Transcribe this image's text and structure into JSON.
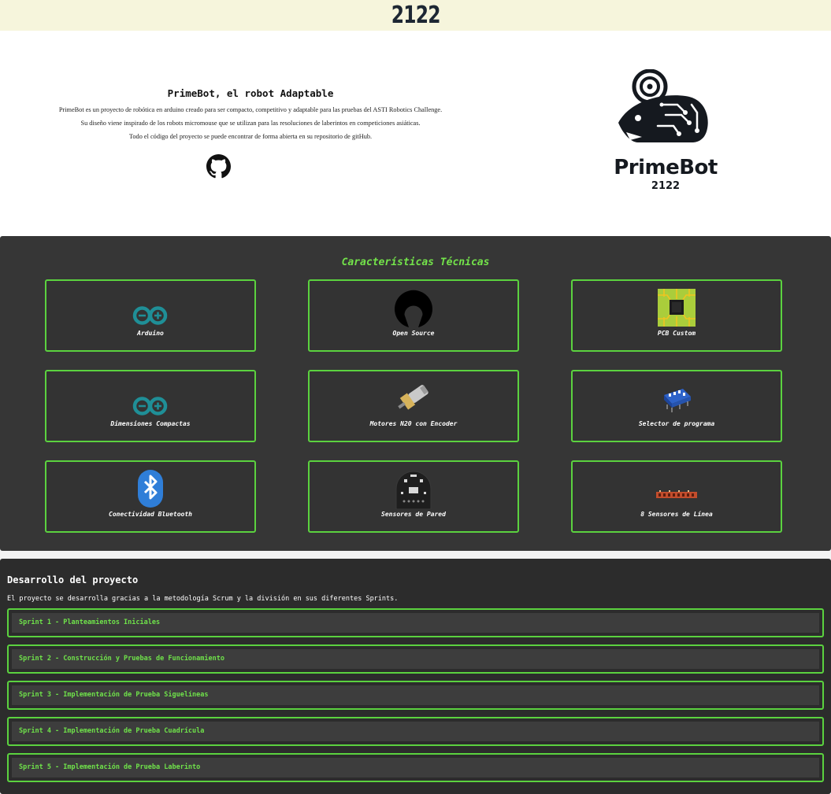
{
  "header": {
    "year": "2122"
  },
  "hero": {
    "title": "PrimeBot, el robot Adaptable",
    "p1": "PrimeBot es un proyecto de robótica en arduino creado para ser compacto, competitivo y adaptable para las pruebas del ASTI Robotics Challenge.",
    "p2": "Su diseño viene inspirado de los robots micromouse que se utilizan para las resoluciones de laberintos en competiciones asiáticas.",
    "p3": "Todo el código del proyecto se puede encontrar de forma abierta en su repositorio de gitHub.",
    "github_icon": "github-icon"
  },
  "logo": {
    "name": "PrimeBot",
    "year": "2122"
  },
  "features": {
    "title": "Características Técnicas",
    "accent": "#5bd23f",
    "items": [
      {
        "label": "Arduino",
        "icon": "arduino-icon"
      },
      {
        "label": "Open Source",
        "icon": "open-source-icon"
      },
      {
        "label": "PCB Custom",
        "icon": "pcb-chip-icon"
      },
      {
        "label": "Dimensiones Compactas",
        "icon": "arduino-icon"
      },
      {
        "label": "Motores N20 con Encoder",
        "icon": "motor-icon"
      },
      {
        "label": "Selector de programa",
        "icon": "dip-switch-icon"
      },
      {
        "label": "Conectividad Bluetooth",
        "icon": "bluetooth-icon"
      },
      {
        "label": "Sensores de Pared",
        "icon": "wall-sensor-icon"
      },
      {
        "label": "8 Sensores de Línea",
        "icon": "line-sensor-icon"
      }
    ]
  },
  "development": {
    "title": "Desarrollo del proyecto",
    "description": "El proyecto se desarrolla gracias a la metodología Scrum y la división en sus diferentes Sprints.",
    "sprints": [
      "Sprint 1 - Planteamientos Iniciales",
      "Sprint 2 - Construcción y Pruebas de Funcionamiento",
      "Sprint 3 - Implementación de Prueba Siguelíneas",
      "Sprint 4 - Implementación de Prueba Cuadrícula",
      "Sprint 5 - Implementación de Prueba Laberinto"
    ]
  }
}
